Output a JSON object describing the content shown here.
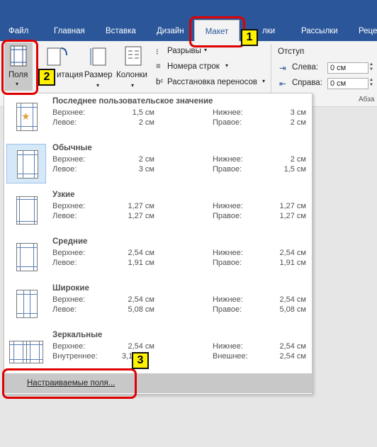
{
  "tabs": {
    "file": "Файл",
    "home": "Главная",
    "insert": "Вставка",
    "design": "Дизайн",
    "layout": "Макет",
    "references": "лки",
    "mailings": "Рассылки",
    "review": "Реце"
  },
  "ribbon": {
    "margins": "Поля",
    "orientation": "итация",
    "size": "Размер",
    "columns": "Колонки",
    "breaks": "Разрывы",
    "line_numbers": "Номера строк",
    "hyphenation": "Расстановка переносов",
    "indent_header": "Отступ",
    "left_label": "Слева:",
    "left_value": "0 см",
    "right_label": "Справа:",
    "right_value": "0 см",
    "group_label": "Абза"
  },
  "margins": [
    {
      "name": "Последнее пользовательское значение",
      "top_label": "Верхнее:",
      "top": "1,5 см",
      "bottom_label": "Нижнее:",
      "bottom": "3 см",
      "left_label": "Левое:",
      "left": "2 см",
      "right_label": "Правое:",
      "right": "2 см"
    },
    {
      "name": "Обычные",
      "top_label": "Верхнее:",
      "top": "2 см",
      "bottom_label": "Нижнее:",
      "bottom": "2 см",
      "left_label": "Левое:",
      "left": "3 см",
      "right_label": "Правое:",
      "right": "1,5 см"
    },
    {
      "name": "Узкие",
      "top_label": "Верхнее:",
      "top": "1,27 см",
      "bottom_label": "Нижнее:",
      "bottom": "1,27 см",
      "left_label": "Левое:",
      "left": "1,27 см",
      "right_label": "Правое:",
      "right": "1,27 см"
    },
    {
      "name": "Средние",
      "top_label": "Верхнее:",
      "top": "2,54 см",
      "bottom_label": "Нижнее:",
      "bottom": "2,54 см",
      "left_label": "Левое:",
      "left": "1,91 см",
      "right_label": "Правое:",
      "right": "1,91 см"
    },
    {
      "name": "Широкие",
      "top_label": "Верхнее:",
      "top": "2,54 см",
      "bottom_label": "Нижнее:",
      "bottom": "2,54 см",
      "left_label": "Левое:",
      "left": "5,08 см",
      "right_label": "Правое:",
      "right": "5,08 см"
    },
    {
      "name": "Зеркальные",
      "top_label": "Верхнее:",
      "top": "2,54 см",
      "bottom_label": "Нижнее:",
      "bottom": "2,54 см",
      "left_label": "Внутреннее:",
      "left": "3,18",
      "right_label": "Внешнее:",
      "right": "2,54 см"
    }
  ],
  "custom_margins": "Настраиваемые поля...",
  "badges": {
    "one": "1",
    "two": "2",
    "three": "3"
  },
  "colors": {
    "accent": "#2b579a",
    "highlight": "#e00000",
    "badge": "#fff200"
  }
}
